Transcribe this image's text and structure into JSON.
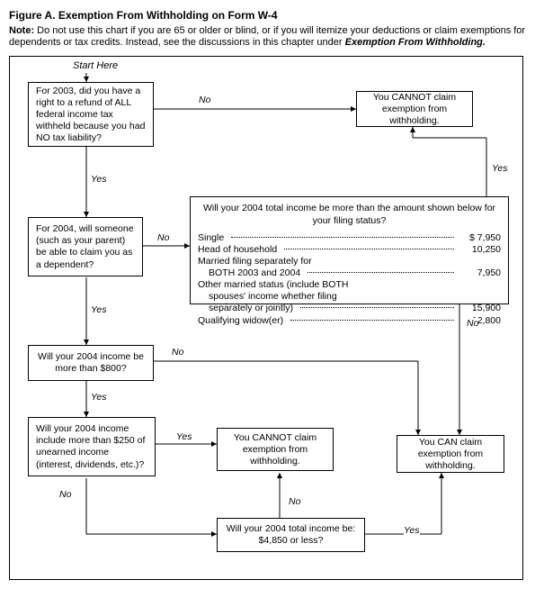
{
  "figure_label": "Figure A.",
  "title": "Exemption From Withholding on Form W-4",
  "note_prefix": "Note:",
  "note_body": "Do not use this chart if you are 65 or older or blind, or if you will itemize your deductions or claim exemptions for dependents or tax credits. Instead, see the discussions in this chapter under",
  "note_emphasis": "Exemption From Withholding.",
  "start_here": "Start Here",
  "labels": {
    "yes": "Yes",
    "no": "No"
  },
  "boxes": {
    "q1": "For 2003, did you have a right to a refund of ALL federal income tax withheld because you had NO tax liability?",
    "cannot_top": "You CANNOT claim exemption from withholding.",
    "q2": "For 2004, will someone (such as your parent) be able to claim you as a dependent?",
    "income_q": "Will your 2004 total income be more than the amount shown below for your filing status?",
    "income_rows": {
      "single": "Single",
      "single_amt": "$ 7,950",
      "hoh": "Head of household",
      "hoh_amt": "10,250",
      "mfs": "Married filing separately for",
      "mfs2": "BOTH 2003 and 2004",
      "mfs_amt": "7,950",
      "other": "Other married status (include BOTH",
      "other2": "spouses' income whether filing",
      "other3": "separately or jointly)",
      "other_amt": "15,900",
      "qw": "Qualifying widow(er)",
      "qw_amt": "12,800"
    },
    "q3": "Will your 2004 income be more than $800?",
    "q4": "Will your 2004 income include more than $250 of unearned income (interest, dividends, etc.)?",
    "cannot_mid": "You CANNOT claim exemption from withholding.",
    "can": "You CAN claim exemption from withholding.",
    "q5": "Will your 2004 total income be: $4,850 or less?"
  }
}
